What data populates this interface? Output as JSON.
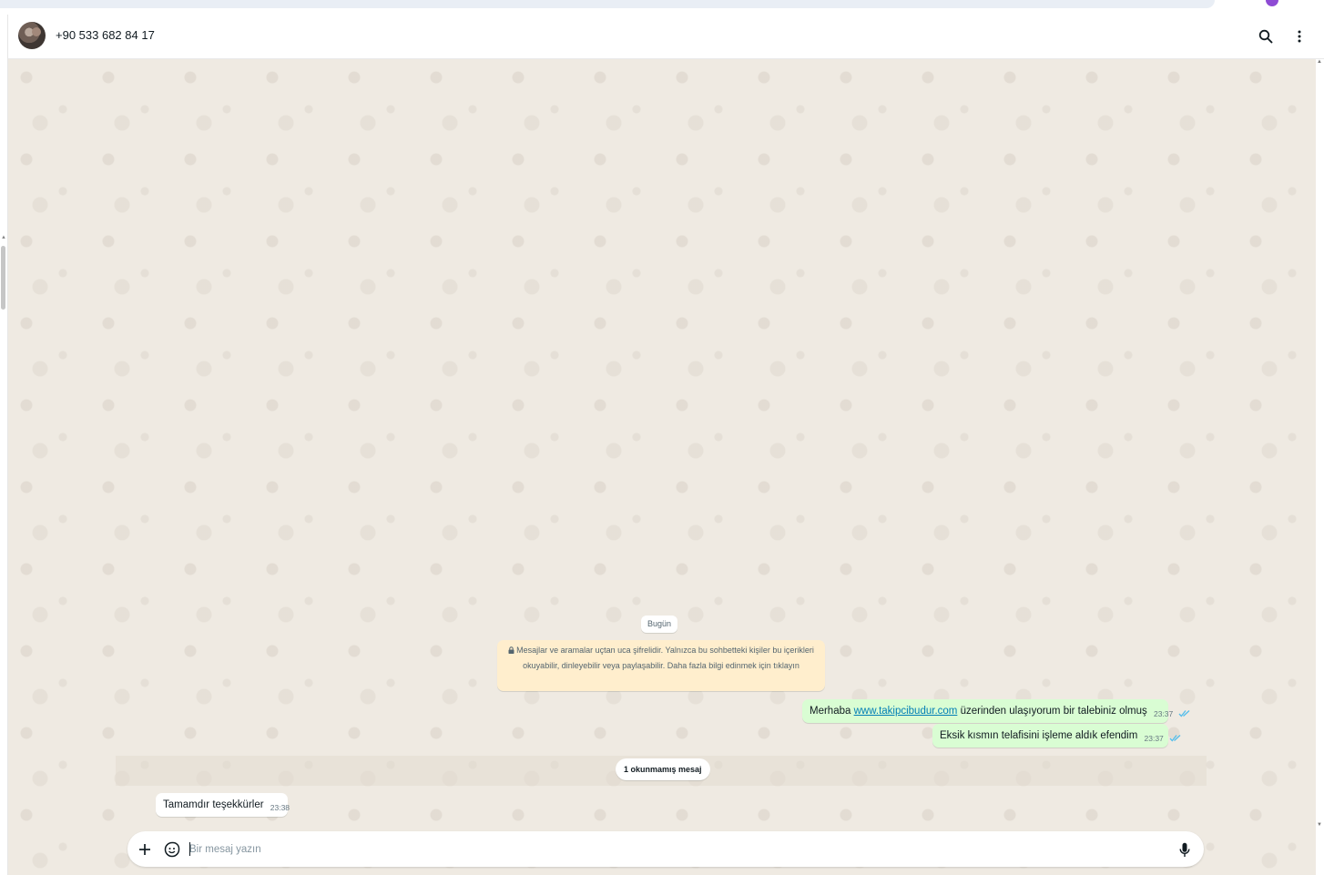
{
  "header": {
    "contact_name": "+90 533 682 84 17",
    "icons": [
      "search-icon",
      "more-vertical-icon"
    ]
  },
  "chat": {
    "date_divider": "Bugün",
    "encryption_notice": "Mesajlar ve aramalar uçtan uca şifrelidir. Yalnızca bu sohbetteki kişiler bu içerikleri okuyabilir, dinleyebilir veya paylaşabilir. Daha fazla bilgi edinmek için tıklayın",
    "messages": [
      {
        "direction": "out",
        "text_before": "Merhaba ",
        "link": "www.takipcibudur.com",
        "text_after": " üzerinden ulaşıyorum bir talebiniz olmuş",
        "time": "23:37",
        "status": "read"
      },
      {
        "direction": "out",
        "text": "Eksik kısmın telafisini işleme aldık efendim",
        "time": "23:37",
        "status": "read"
      },
      {
        "direction": "in",
        "text": "Tamamdır teşekkürler",
        "time": "23:38"
      }
    ],
    "unread_divider": "1 okunmamış mesaj"
  },
  "composer": {
    "placeholder": "Bir mesaj yazın",
    "value": "",
    "icons": [
      "plus-icon",
      "sticker-icon",
      "microphone-icon"
    ]
  },
  "colors": {
    "outgoing_bubble": "#d9fdd3",
    "incoming_bubble": "#ffffff",
    "chat_background": "#efeae2",
    "encryption_notice_bg": "#ffeecd",
    "link": "#027eb5",
    "read_ticks": "#53bdeb"
  }
}
